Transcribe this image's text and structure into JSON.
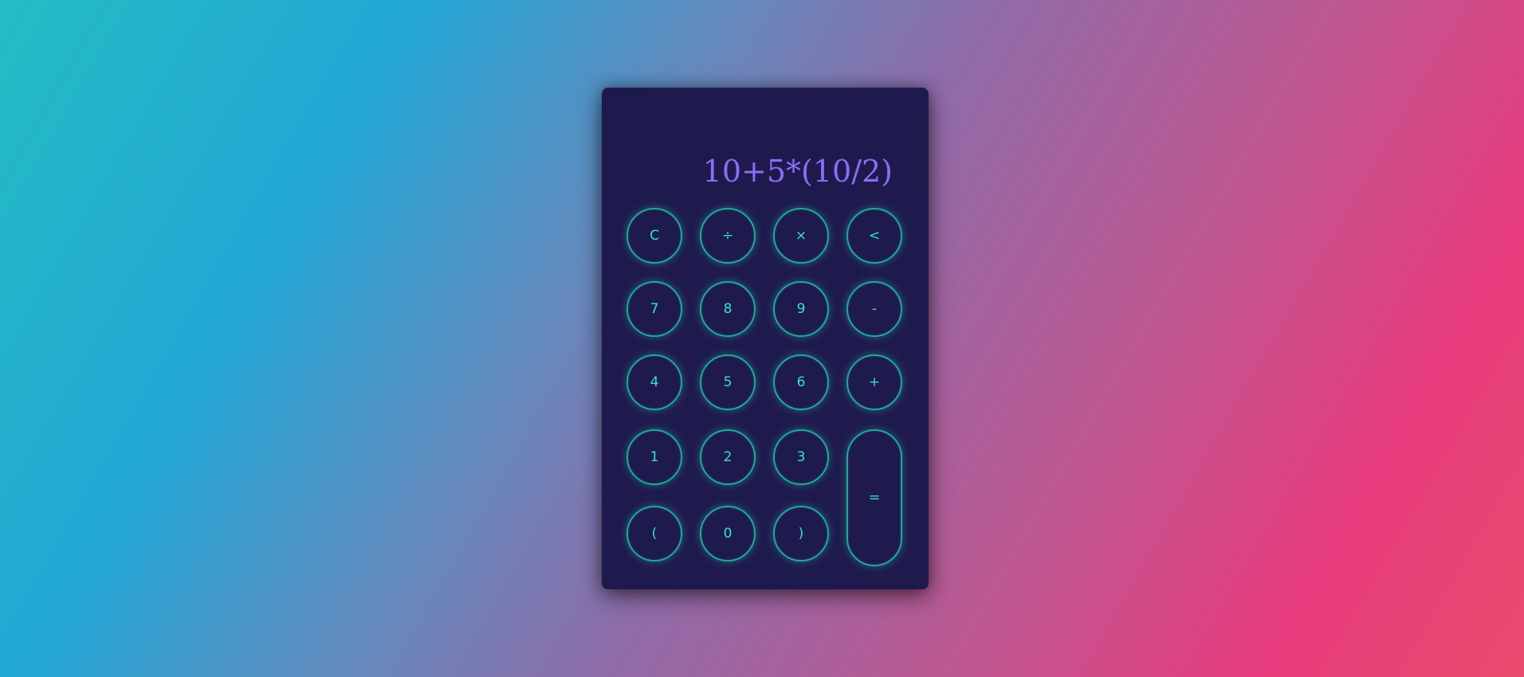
{
  "display": {
    "expression": "10+5*(10/2)"
  },
  "buttons": {
    "clear": "C",
    "divide": "÷",
    "multiply": "×",
    "backspace": "<",
    "seven": "7",
    "eight": "8",
    "nine": "9",
    "minus": "-",
    "four": "4",
    "five": "5",
    "six": "6",
    "plus": "+",
    "one": "1",
    "two": "2",
    "three": "3",
    "equals": "=",
    "open_paren": "(",
    "zero": "0",
    "close_paren": ")"
  },
  "colors": {
    "panel": "#1f1a4e",
    "display_text": "#8a6ef2",
    "button_text": "#2ee6c6",
    "button_border": "#20a898"
  }
}
